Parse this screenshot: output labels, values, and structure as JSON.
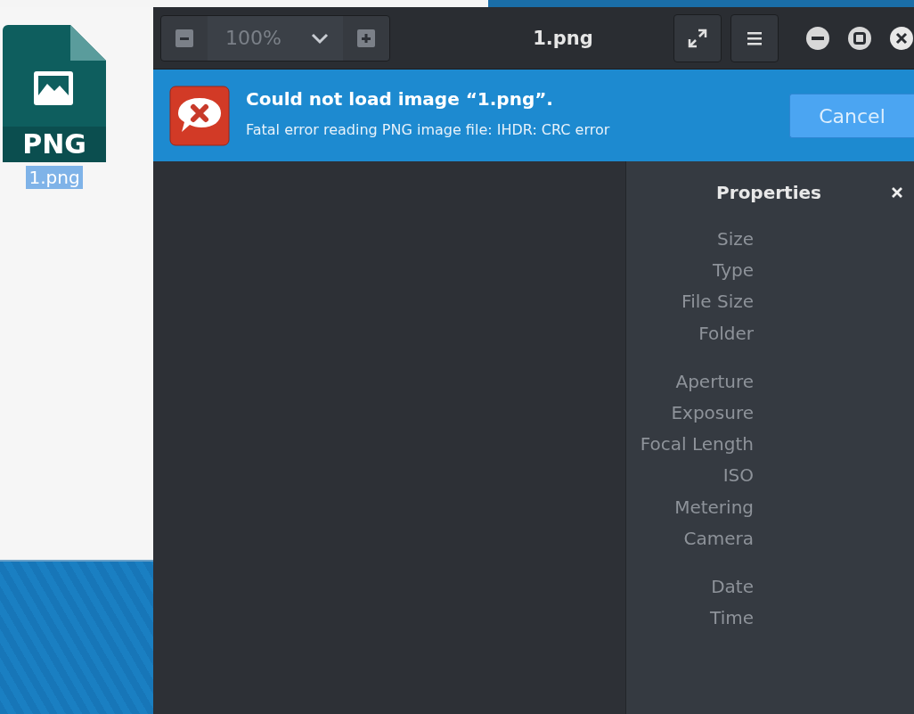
{
  "desktop": {
    "icons": [
      {
        "badge": "PNG",
        "label": "1.png",
        "selected": true
      }
    ]
  },
  "window": {
    "title": "1.png",
    "zoom": {
      "value": "100%"
    },
    "infobar": {
      "title": "Could not load image “1.png”.",
      "message": "Fatal error reading PNG image file: IHDR: CRC error",
      "button": "Cancel"
    },
    "properties": {
      "title": "Properties",
      "groups": [
        {
          "labels": [
            "Size",
            "Type",
            "File Size",
            "Folder"
          ]
        },
        {
          "labels": [
            "Aperture",
            "Exposure",
            "Focal Length",
            "ISO",
            "Metering",
            "Camera"
          ]
        },
        {
          "labels": [
            "Date",
            "Time"
          ]
        }
      ]
    }
  }
}
